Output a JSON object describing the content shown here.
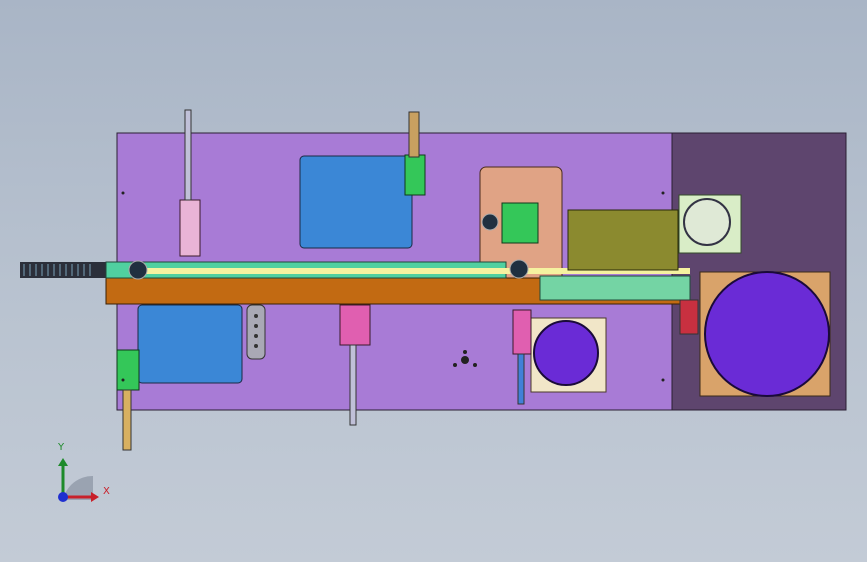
{
  "viewport": {
    "background_top": "#a9b5c6",
    "background_bottom": "#c3cbd6"
  },
  "triad": {
    "x_label": "X",
    "y_label": "Y",
    "x_color": "#c8202a",
    "y_color": "#1d8a2a",
    "z_color": "#1f2fd0"
  },
  "colors": {
    "base_plate": "#a87bd6",
    "base_plate_dark": "#5e456e",
    "blue_plate": "#3b87d6",
    "peach_plate": "#e0a385",
    "orange_rail": "#c26a12",
    "olive_block": "#8b8a2f",
    "green_part": "#34c759",
    "cream_plate": "#f1e6c8",
    "bowl_purple": "#6a2bd6",
    "pink_cylinder": "#e05fb0"
  }
}
